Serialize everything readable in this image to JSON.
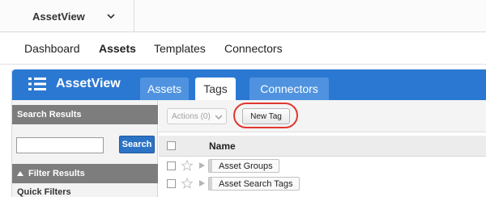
{
  "app_switcher": {
    "name": "AssetView"
  },
  "module_nav": {
    "items": [
      "Dashboard",
      "Assets",
      "Templates",
      "Connectors"
    ],
    "active": "Assets"
  },
  "app_header": {
    "title": "AssetView",
    "tabs": [
      {
        "label": "Assets",
        "active": false
      },
      {
        "label": "Tags",
        "active": true
      },
      {
        "label": "Connectors",
        "active": false
      }
    ]
  },
  "left_panel": {
    "search_results_label": "Search Results",
    "search_input_value": "",
    "search_button_label": "Search",
    "filter_results_label": "Filter Results",
    "quick_filters_label": "Quick Filters"
  },
  "toolbar": {
    "actions_label": "Actions (0)",
    "new_tag_label": "New Tag"
  },
  "table": {
    "column_name": "Name",
    "rows": [
      {
        "name": "Asset Groups"
      },
      {
        "name": "Asset Search Tags"
      }
    ]
  },
  "colors": {
    "brand_blue": "#2b78d2",
    "tab_inactive": "#4f93e0",
    "highlight_ring": "#e0372f",
    "panel_header": "#7d7d7d"
  }
}
